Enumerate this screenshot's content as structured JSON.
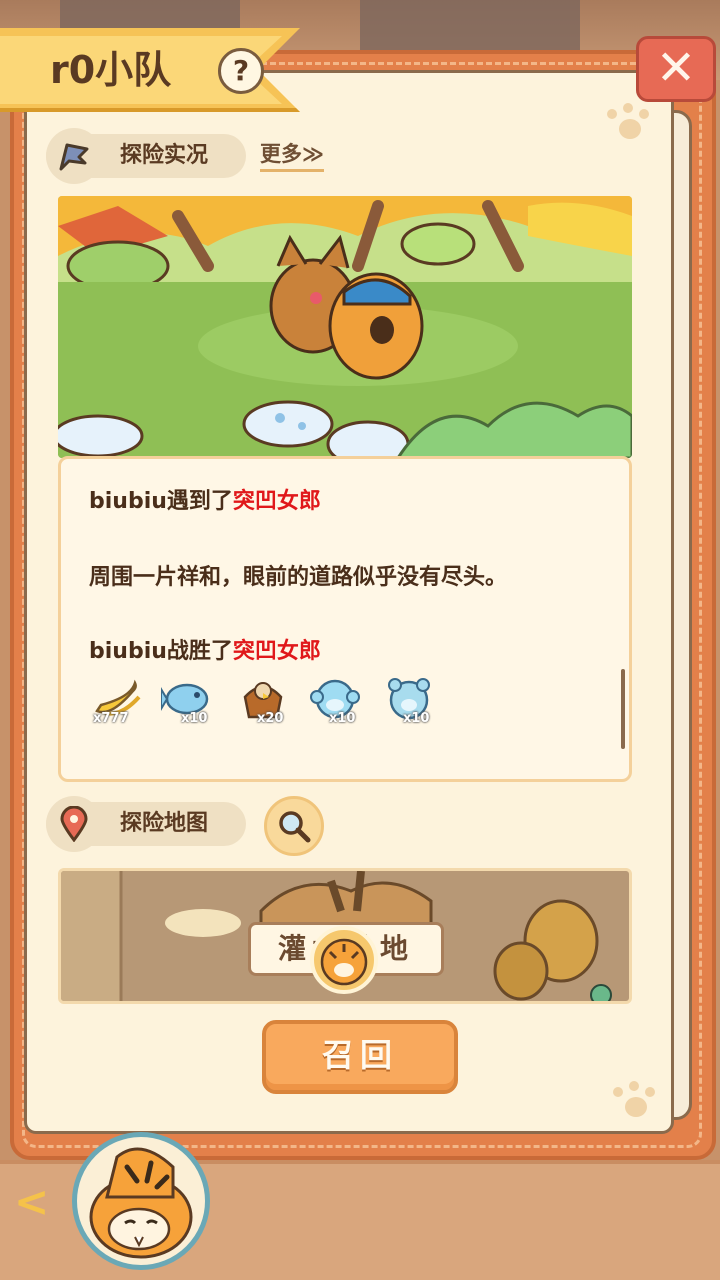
{
  "header": {
    "team_name": "r0小队",
    "help_label": "?",
    "close_label": "✕"
  },
  "live": {
    "section_label": "探险实况",
    "more_label": "更多≫"
  },
  "log": {
    "lines": [
      {
        "actor": "biubiu",
        "verb": "遇到了",
        "enemy": "突凹女郎"
      },
      {
        "text": "周围一片祥和，眼前的道路似乎没有尽头。"
      },
      {
        "actor": "biubiu",
        "verb": "战胜了",
        "enemy": "突凹女郎"
      }
    ],
    "rewards": [
      {
        "icon": "banana-icon",
        "count": "x777"
      },
      {
        "icon": "blue-fish-icon",
        "count": "x10"
      },
      {
        "icon": "eagle-icon",
        "count": "x20"
      },
      {
        "icon": "blue-monkey-icon",
        "count": "x10"
      },
      {
        "icon": "blue-bear-icon",
        "count": "x10"
      }
    ]
  },
  "map": {
    "section_label": "探险地图",
    "location_label": "灌木丛地"
  },
  "actions": {
    "recall_label": "召回",
    "back_label": "<"
  },
  "colors": {
    "enemy_text": "#e0181a",
    "page": "#fdf3dc",
    "book_frame": "#e3804a"
  }
}
